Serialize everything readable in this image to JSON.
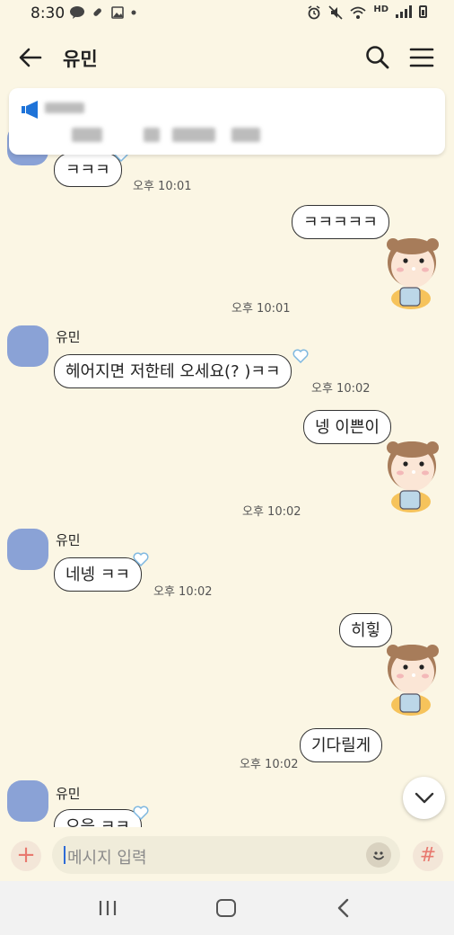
{
  "status_bar": {
    "time": "8:30",
    "hd_label": "HD"
  },
  "header": {
    "title": "유민"
  },
  "input": {
    "placeholder": "메시지 입력",
    "plus_symbol": "+",
    "hash_symbol": "#"
  },
  "messages": {
    "m1": {
      "text": "ㅋㅋㅋ",
      "time": "오후 10:01"
    },
    "m2": {
      "text": "ㅋㅋㅋㅋㅋ",
      "time": "오후 10:01"
    },
    "m3": {
      "sender": "유민",
      "text": "헤어지면 저한테 오세요(? )ㅋㅋ",
      "time": "오후 10:02"
    },
    "m4": {
      "text": "넹 이쁜이",
      "time": "오후 10:02"
    },
    "m5": {
      "sender": "유민",
      "text": "네넹 ㅋㅋ",
      "time": "오후 10:02"
    },
    "m6": {
      "text": "히힣"
    },
    "m7": {
      "text": "기다릴게",
      "time": "오후 10:02"
    },
    "m8": {
      "sender": "유민",
      "text": "으응 ㅋㅋ"
    }
  },
  "colors": {
    "background": "#fbf6e4",
    "avatar": "#8aa2d6",
    "accent": "#e8796f",
    "heart": "#a9d4ef"
  },
  "icons": [
    "back-arrow-icon",
    "search-icon",
    "menu-icon",
    "megaphone-icon",
    "heart-icon",
    "chevron-down-icon",
    "smiley-icon",
    "plus-icon",
    "hash-icon"
  ]
}
